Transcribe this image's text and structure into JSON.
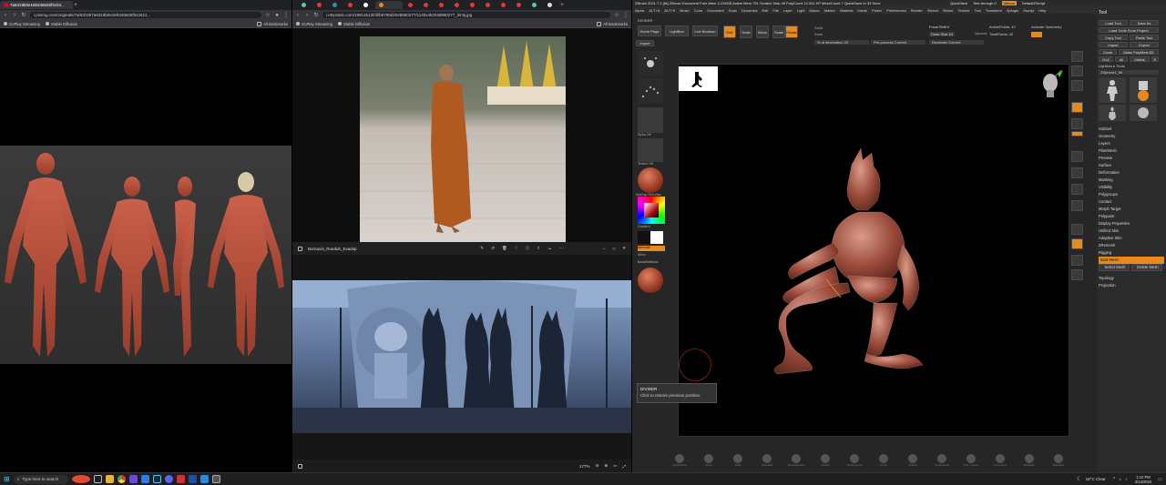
{
  "window1": {
    "tab_title": "7a6319b0e165346626f3c04...",
    "url": "i.pinimg.com/originals/7a/63/19/7a6319b0e165346626f3c0421...",
    "bookmarks": [
      "GoPlay Streaming",
      "Stable Diffusion",
      "All Bookmarks"
    ]
  },
  "window2": {
    "url": "i.ettystatic.com/19914513/r/il/b5799d2048960277/1140x4k2048960277_it/c5j.jpg",
    "bookmarks": [
      "GoPlay Streaming",
      "Stable Diffusion",
      "All Bookmarks"
    ]
  },
  "viewer": {
    "title": "Bornacia_Roeduh_Exadsp",
    "zoom": "177%"
  },
  "zbrush": {
    "title_bar": "ZBrush 2021.7.1 [lik]  ZBrush Document  Free Mem 3.219GB  Active Mem 751  Scratch Disk 49  PolyCount 12.811 KP  MeshCount 7  QuickSave In 33 Secs",
    "quicksave": "QuickSave",
    "see_through": "See-through 0",
    "menus_btn": "Menus",
    "default_zscript": "DefaultZScript",
    "menu": [
      "Alpha",
      "ALT+A",
      "ALT+S",
      "Brush",
      "Color",
      "Document",
      "Draw",
      "Dynamics",
      "Edit",
      "File",
      "Layer",
      "Light",
      "Macro",
      "Marker",
      "Material",
      "Movie",
      "Picker",
      "Preferences",
      "Render",
      "Stencil",
      "Stroke",
      "Texture",
      "Tool",
      "Transform",
      "Zplugin",
      "Zscript",
      "Help"
    ],
    "divider_label": "DIVIDER",
    "toolbar": {
      "home_page": "Home Page",
      "lightbox": "LightBox",
      "live_boolean": "Live Boolean",
      "edit": "Edit",
      "draw": "Draw",
      "move": "Move",
      "scale": "Scale",
      "rotate": "Rotate",
      "focal_shift": "Focal Shift 0",
      "draw_size": "Draw Size 44",
      "dynamic": "Dynamic",
      "active_points": "ActivePoints: 42",
      "total_points": "TotalPoints: 42",
      "activate_symmetry": "Activate Symmetry",
      "sdiv_label": "% of decimation 20",
      "preprocess": "Pre-process Current",
      "decimate": "Decimate Current",
      "import": "Import",
      "export": "Export",
      "zadd": "Zadd",
      "zsub": "Zsub"
    },
    "left_panel": [
      "Alpha Off",
      "Texture Off",
      "MatCap Red Wax",
      "Gradient",
      "SwitchColor",
      "Alternate",
      "Mirror",
      "BasicMatMask"
    ],
    "tooltip": {
      "title": "DIVIDER",
      "text": "Click to restore previous position."
    },
    "tool_panel": {
      "header": "Tool",
      "buttons": [
        "Load Tool",
        "Save As",
        "Load Tools From Project",
        "Copy Tool",
        "Paste Tool",
        "Import",
        "Export",
        "Clone",
        "Make PolyMesh3D",
        "GoZ",
        "All",
        "Visible",
        "R"
      ],
      "lightbox_tools": "Lightbox ▸ Tools",
      "zsphere": "ZSphere1_69",
      "items": [
        "Subtool",
        "Geometry",
        "Layers",
        "FiberMesh",
        "Preview",
        "Surface",
        "Deformation",
        "Masking",
        "Visibility",
        "Polygroups",
        "Contact",
        "Morph Target",
        "Polypaint",
        "Display Properties",
        "Unified Skin",
        "Adaptive Skin",
        "ZRemesh",
        "Rigging",
        "Bind Mesh",
        "Select Mesh",
        "Delete Mesh",
        "Topology",
        "Projection"
      ]
    },
    "bottom_brushes": [
      "ClayBuildup",
      "Move",
      "Inflat",
      "Standard",
      "DamStandard",
      "hPolish",
      "TrimDynamic",
      "Pinch",
      "Slash3",
      "SnakeHook",
      "Orb_Cracks",
      "CurveTube",
      "ZModeler",
      "MaskPen"
    ]
  },
  "taskbar": {
    "search_placeholder": "Type here to search",
    "weather": "18°C Clear",
    "time": "1:10 PM",
    "date": "3/14/2024"
  },
  "colors": {
    "accent_orange": "#e8891e",
    "chrome_dark": "#202124",
    "zbrush_gray": "#2a2a2a",
    "statue_blue": "#6c86b0"
  }
}
